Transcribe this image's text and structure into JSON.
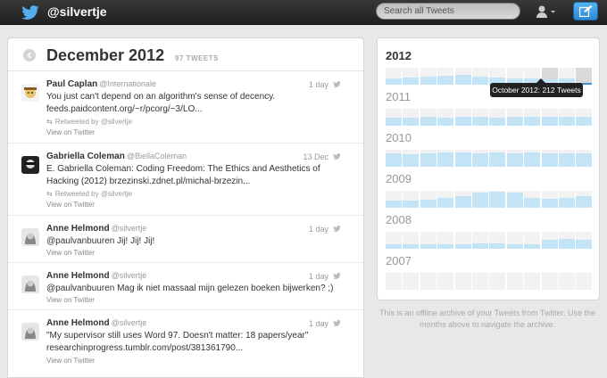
{
  "header": {
    "handle": "@silvertje",
    "search_placeholder": "Search all Tweets"
  },
  "timeline": {
    "title": "December 2012",
    "count": "97 TWEETS",
    "tweets": [
      {
        "name": "Paul Caplan",
        "username": "@Internationale",
        "time": "1 day",
        "text": "You just can't depend on an algorithm's sense of decency. feeds.paidcontent.org/~r/pcorg/~3/LO...",
        "retweeted_by": "Retweeted by @silvertje",
        "view": "View on Twitter"
      },
      {
        "name": "Gabriella Coleman",
        "username": "@BiellaColeman",
        "time": "13 Dec",
        "text": "E. Gabriella Coleman: Coding Freedom: The Ethics and Aesthetics of Hacking (2012) brzezinski.zdnet.pl/michal-brzezin...",
        "retweeted_by": "Retweeted by @silvertje",
        "view": "View on Twitter"
      },
      {
        "name": "Anne Helmond",
        "username": "@silvertje",
        "time": "1 day",
        "text": "@paulvanbuuren Jij! Jij! Jij!",
        "view": "View on Twitter"
      },
      {
        "name": "Anne Helmond",
        "username": "@silvertje",
        "time": "1 day",
        "text": "@paulvanbuuren Mag ik niet massaal mijn gelezen boeken bijwerken? ;)",
        "view": "View on Twitter"
      },
      {
        "name": "Anne Helmond",
        "username": "@silvertje",
        "time": "1 day",
        "text": "\"My supervisor still uses Word 97. Doesn't matter: 18 papers/year\" researchinprogress.tumblr.com/post/381361790...",
        "view": "View on Twitter"
      }
    ]
  },
  "archive": {
    "tooltip": "October 2012: 212 Tweets",
    "selected_year": "2012",
    "selected_month_index": 11,
    "hover_month_index": 9,
    "years": [
      {
        "year": "2012",
        "levels": [
          0.35,
          0.4,
          0.45,
          0.5,
          0.6,
          0.45,
          0.4,
          0.35,
          0.35,
          0.3,
          0.35,
          0.15
        ]
      },
      {
        "year": "2011",
        "levels": [
          0.45,
          0.45,
          0.5,
          0.45,
          0.5,
          0.5,
          0.45,
          0.5,
          0.5,
          0.55,
          0.55,
          0.55
        ]
      },
      {
        "year": "2010",
        "levels": [
          0.8,
          0.75,
          0.8,
          0.85,
          0.85,
          0.8,
          0.85,
          0.8,
          0.85,
          0.8,
          0.8,
          0.8
        ]
      },
      {
        "year": "2009",
        "levels": [
          0.4,
          0.4,
          0.45,
          0.6,
          0.7,
          0.9,
          0.95,
          0.9,
          0.6,
          0.5,
          0.6,
          0.7
        ]
      },
      {
        "year": "2008",
        "levels": [
          0.25,
          0.25,
          0.25,
          0.25,
          0.25,
          0.3,
          0.3,
          0.25,
          0.25,
          0.5,
          0.6,
          0.55
        ]
      },
      {
        "year": "2007",
        "levels": [
          0.0,
          0.0,
          0.0,
          0.0,
          0.0,
          0.0,
          0.0,
          0.0,
          0.0,
          0.0,
          0.0,
          0.0
        ]
      }
    ],
    "note": "This is an offline archive of your Tweets from Twitter. Use the months above to navigate the archive."
  },
  "colors": {
    "accent": "#2a8ad6",
    "bar_fill": "#c3e4f6",
    "topbar": "#2a2a2a"
  }
}
